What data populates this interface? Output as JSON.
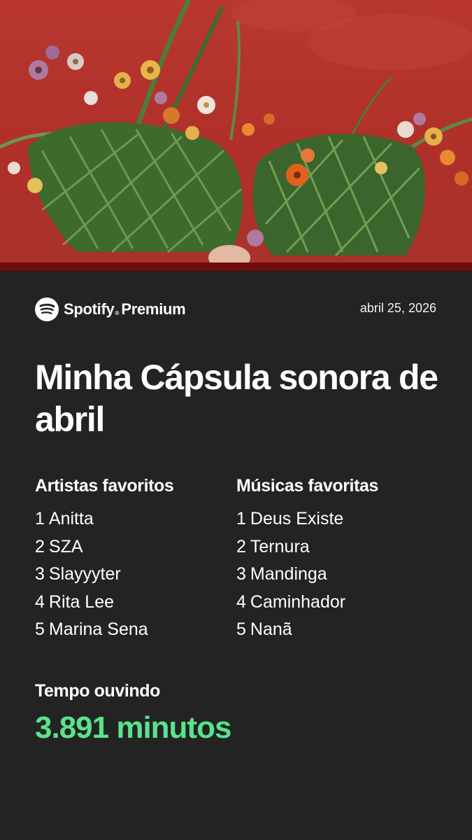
{
  "brand": {
    "name": "Spotify",
    "mark": "®",
    "tier": "Premium",
    "icon": "spotify-logo-icon"
  },
  "date": "abril 25, 2026",
  "title": "Minha Cápsula sonora de abril",
  "artists": {
    "heading": "Artistas favoritos",
    "items": [
      {
        "rank": "1",
        "name": "Anitta"
      },
      {
        "rank": "2",
        "name": "SZA"
      },
      {
        "rank": "3",
        "name": "Slayyyter"
      },
      {
        "rank": "4",
        "name": "Rita Lee"
      },
      {
        "rank": "5",
        "name": "Marina Sena"
      }
    ]
  },
  "songs": {
    "heading": "Músicas favoritas",
    "items": [
      {
        "rank": "1",
        "name": "Deus Existe"
      },
      {
        "rank": "2",
        "name": "Ternura"
      },
      {
        "rank": "3",
        "name": "Mandinga"
      },
      {
        "rank": "4",
        "name": "Caminhador"
      },
      {
        "rank": "5",
        "name": "Nanã"
      }
    ]
  },
  "listening": {
    "label": "Tempo ouvindo",
    "value": "3.891 minutos"
  },
  "colors": {
    "background": "#232323",
    "accent": "#59e38c",
    "cover_red": "#b0302a",
    "cover_strip": "#6e0d0b"
  }
}
